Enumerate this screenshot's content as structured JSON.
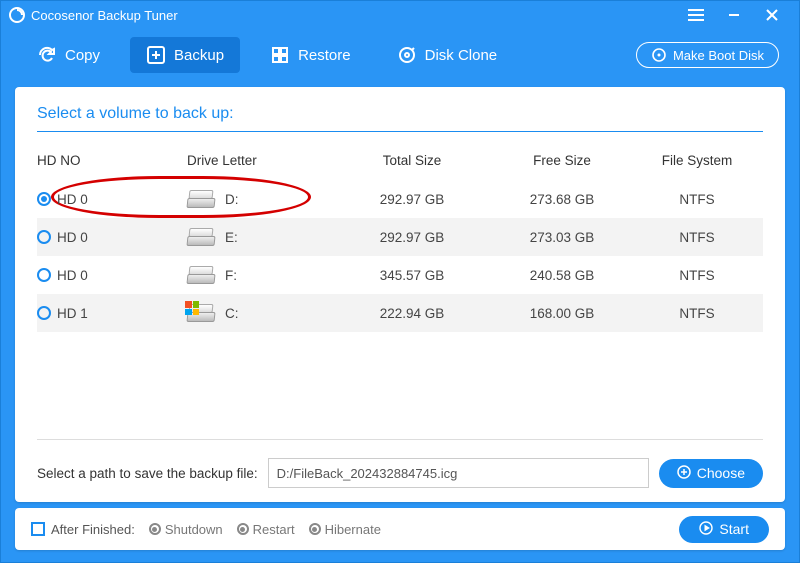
{
  "app": {
    "title": "Cocosenor Backup Tuner"
  },
  "toolbar": {
    "copy": "Copy",
    "backup": "Backup",
    "restore": "Restore",
    "diskclone": "Disk Clone",
    "bootdisk": "Make Boot Disk"
  },
  "panel": {
    "title": "Select a volume to back up:",
    "columns": {
      "hdno": "HD NO",
      "drive": "Drive Letter",
      "total": "Total Size",
      "free": "Free Size",
      "fs": "File System"
    },
    "rows": [
      {
        "selected": true,
        "hd": "HD 0",
        "letter": "D:",
        "total": "292.97 GB",
        "free": "273.68 GB",
        "fs": "NTFS",
        "windows": false
      },
      {
        "selected": false,
        "hd": "HD 0",
        "letter": "E:",
        "total": "292.97 GB",
        "free": "273.03 GB",
        "fs": "NTFS",
        "windows": false
      },
      {
        "selected": false,
        "hd": "HD 0",
        "letter": "F:",
        "total": "345.57 GB",
        "free": "240.58 GB",
        "fs": "NTFS",
        "windows": false
      },
      {
        "selected": false,
        "hd": "HD 1",
        "letter": "C:",
        "total": "222.94 GB",
        "free": "168.00 GB",
        "fs": "NTFS",
        "windows": true
      }
    ],
    "path_label": "Select a path to save the backup file:",
    "path_value": "D:/FileBack_202432884745.icg",
    "choose": "Choose"
  },
  "bottom": {
    "after_label": "After Finished:",
    "shutdown": "Shutdown",
    "restart": "Restart",
    "hibernate": "Hibernate",
    "start": "Start"
  }
}
